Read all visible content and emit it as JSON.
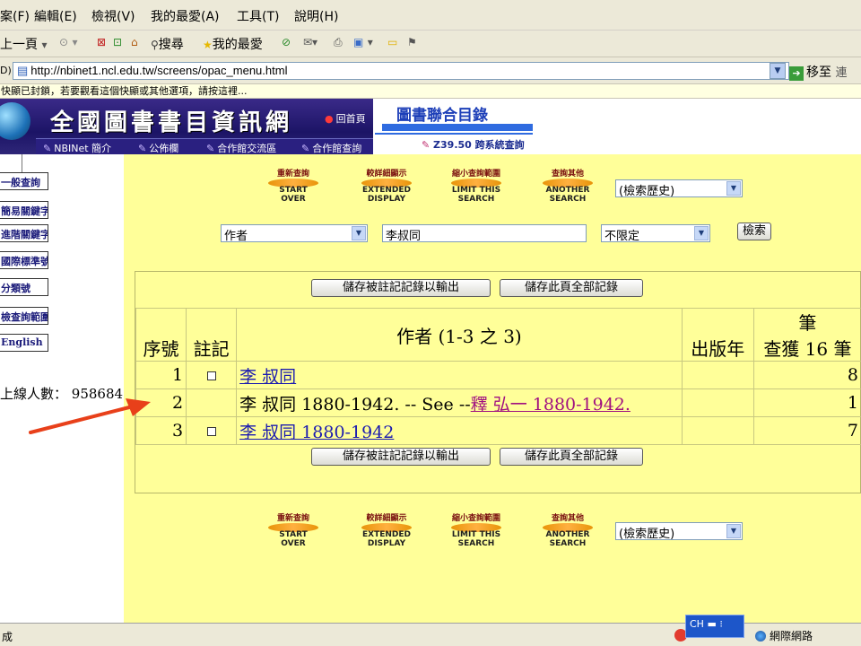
{
  "browser": {
    "menu": [
      "案(F)",
      "編輯(E)",
      "檢視(V)",
      "我的最愛(A)",
      "工具(T)",
      "說明(H)"
    ],
    "toolbar": {
      "back_label": "上一頁",
      "search_label": "搜尋",
      "favorites_label": "我的最愛"
    },
    "address": {
      "value": "http://nbinet1.ncl.edu.tw/screens/opac_menu.html",
      "go_label": "移至",
      "links_label": "連"
    },
    "info_bar": "快顯已封鎖，若要觀看這個快顯或其他選項，請按這裡..."
  },
  "banner": {
    "site_title": "全國圖書書目資訊網",
    "home_label": "回首頁",
    "nav": [
      "NBINet 簡介",
      "公佈欄",
      "合作館交流區",
      "合作館查詢"
    ],
    "union_catalog": "圖書聯合目錄",
    "z3950": "Z39.50 跨系統查詢"
  },
  "sidebar": {
    "items": [
      "一般查詢",
      "簡易關鍵字",
      "進階關鍵字",
      "國際標準號碼",
      "分類號",
      "檢查詢範圍",
      "English"
    ],
    "visitor_label": "上線人數：",
    "visitor_count": "958684"
  },
  "nav_buttons": [
    {
      "zh": "重新查詢",
      "en": "START OVER"
    },
    {
      "zh": "較詳細顯示",
      "en": "EXTENDED DISPLAY"
    },
    {
      "zh": "縮小查詢範圍",
      "en": "LIMIT THIS SEARCH"
    },
    {
      "zh": "查詢其他",
      "en": "ANOTHER SEARCH"
    }
  ],
  "history_select": "(檢索歷史)",
  "search": {
    "field": "作者",
    "query": "李叔同",
    "limit": "不限定",
    "submit": "檢索"
  },
  "results": {
    "save_marked": "儲存被註記記錄以輸出",
    "save_page": "儲存此頁全部記錄",
    "headers": {
      "seq": "序號",
      "mark": "註記",
      "author": "作者 (1-3 之 3)",
      "year": "出版年",
      "count_top": "筆",
      "count": "查獲 16 筆"
    },
    "rows": [
      {
        "seq": "1",
        "author": "李 叔同",
        "year": "",
        "count": "8"
      },
      {
        "seq": "2",
        "author_prefix": "李 叔同 1880-1942. -- See --",
        "author_link": "釋 弘一 1880-1942.",
        "year": "",
        "count": "1"
      },
      {
        "seq": "3",
        "author": "李 叔同 1880-1942",
        "year": "",
        "count": "7"
      }
    ]
  },
  "status": {
    "text": "成",
    "ime": "CH",
    "zone": "網際網路"
  },
  "colors": {
    "main_bg": "#ffff99",
    "banner_bg": "#1c1466",
    "arrow": "#e8401a"
  }
}
